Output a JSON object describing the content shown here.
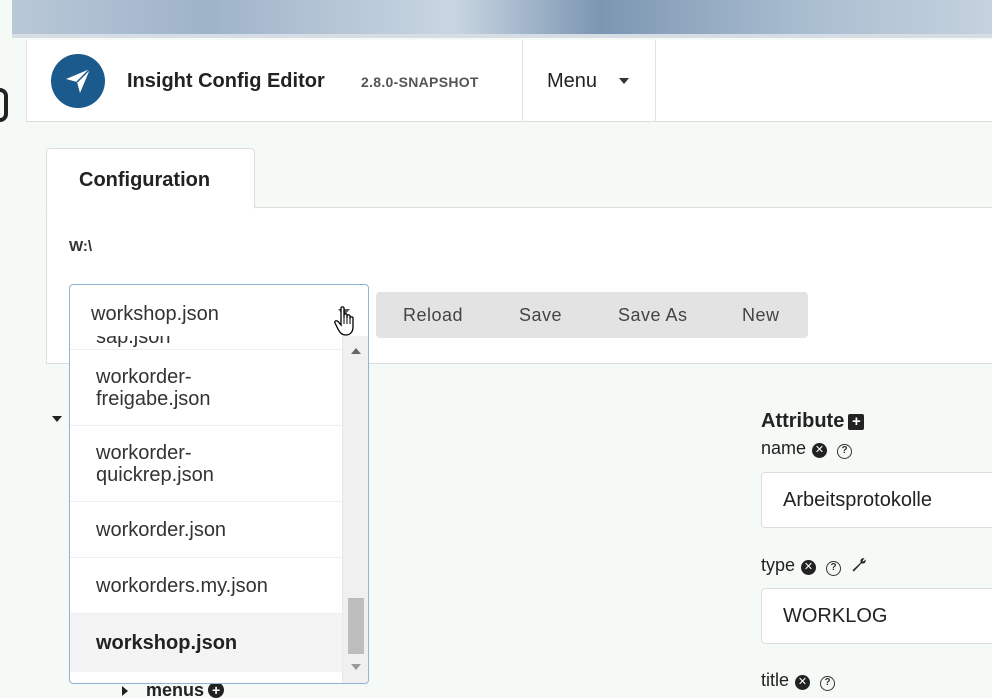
{
  "app": {
    "title": "Insight Config Editor",
    "version": "2.8.0-SNAPSHOT",
    "menu_label": "Menu"
  },
  "tabs": [
    {
      "label": "Configuration",
      "active": true
    }
  ],
  "config": {
    "path": "W:\\",
    "file_select": {
      "value": "workshop.json",
      "options": [
        "sap.json",
        "workorder-\nfreigabe.json",
        "workorder-\nquickrep.json",
        "workorder.json",
        "workorders.my.json",
        "workshop.json"
      ],
      "selected_index": 5
    },
    "buttons": {
      "reload": "Reload",
      "save": "Save",
      "save_as": "Save As",
      "new": "New"
    }
  },
  "tree": {
    "menus_label": "menus"
  },
  "attributes": {
    "title": "Attribute",
    "fields": [
      {
        "label": "name",
        "value": "Arbeitsprotokolle"
      },
      {
        "label": "type",
        "value": "WORKLOG"
      },
      {
        "label": "title",
        "value": ""
      }
    ]
  },
  "icons": {
    "logo": "paper-plane-icon",
    "add_attribute": "plus-square-icon",
    "remove": "remove-circle-icon",
    "help": "question-circle-icon",
    "edit": "wrench-icon",
    "add_menu": "plus-circle-icon"
  },
  "colors": {
    "brand": "#1b5a8c",
    "select_border": "#8fb4d6"
  }
}
